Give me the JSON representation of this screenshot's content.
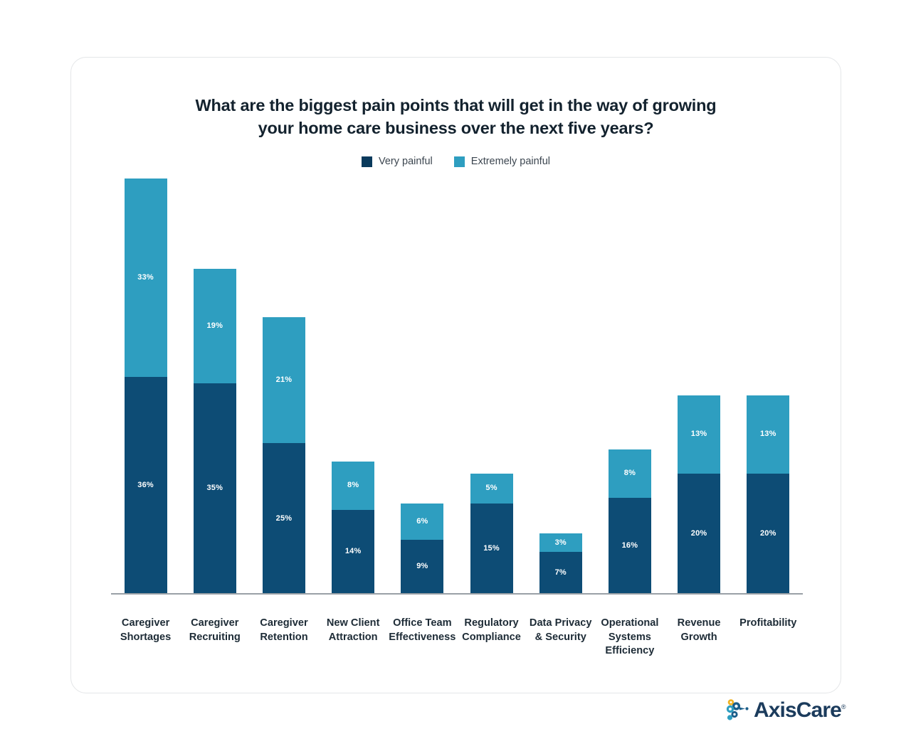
{
  "brand": {
    "name": "AxisCare",
    "trademark": "®",
    "logo_icon": "axiscare-helix-icon",
    "word_color": "#1b3b5c",
    "mark_colors": [
      "#f0b323",
      "#2e9ec0",
      "#1b5e8a"
    ]
  },
  "colors": {
    "very_painful": "#0d4c75",
    "extremely_painful": "#2e9ec0",
    "legend_very_painful": "#0a3a5c",
    "axis": "#9aa0a6",
    "title_text": "#13222e",
    "label_text": "#1d2b36",
    "card_border": "#e4e6e8",
    "background": "#ffffff"
  },
  "chart_data": {
    "type": "bar",
    "title": "What are the biggest pain points that will get in the way of growing your home care business over the next five years?",
    "title_lines": [
      "What are the biggest pain points that will get in the way of growing",
      "your home care business over the next five years?"
    ],
    "subtitle": "",
    "xlabel": "",
    "ylabel": "",
    "stacked": true,
    "grid": false,
    "legend_position": "top",
    "ylim": [
      0,
      69
    ],
    "value_suffix": "%",
    "categories": [
      "Caregiver Shortages",
      "Caregiver Recruiting",
      "Caregiver Retention",
      "New Client Attraction",
      "Office Team Effectiveness",
      "Regulatory Compliance",
      "Data Privacy & Security",
      "Operational Systems Efficiency",
      "Revenue Growth",
      "Profitability"
    ],
    "category_lines": [
      [
        "Caregiver",
        "Shortages"
      ],
      [
        "Caregiver",
        "Recruiting"
      ],
      [
        "Caregiver",
        "Retention"
      ],
      [
        "New Client",
        "Attraction"
      ],
      [
        "Office Team",
        "Effectiveness"
      ],
      [
        "Regulatory",
        "Compliance"
      ],
      [
        "Data Privacy",
        "& Security"
      ],
      [
        "Operational",
        "Systems",
        "Efficiency"
      ],
      [
        "Revenue",
        "Growth"
      ],
      [
        "Profitability"
      ]
    ],
    "series": [
      {
        "name": "Very painful",
        "color": "#0d4c75",
        "values": [
          36,
          35,
          25,
          14,
          9,
          15,
          7,
          16,
          20,
          20
        ],
        "labels": [
          "36%",
          "35%",
          "25%",
          "14%",
          "9%",
          "15%",
          "7%",
          "16%",
          "20%",
          "20%"
        ]
      },
      {
        "name": "Extremely painful",
        "color": "#2e9ec0",
        "values": [
          33,
          19,
          21,
          8,
          6,
          5,
          3,
          8,
          13,
          13
        ],
        "labels": [
          "33%",
          "19%",
          "21%",
          "8%",
          "6%",
          "5%",
          "3%",
          "8%",
          "13%",
          "13%"
        ]
      }
    ],
    "totals": [
      69,
      54,
      46,
      22,
      15,
      20,
      10,
      24,
      33,
      33
    ]
  }
}
